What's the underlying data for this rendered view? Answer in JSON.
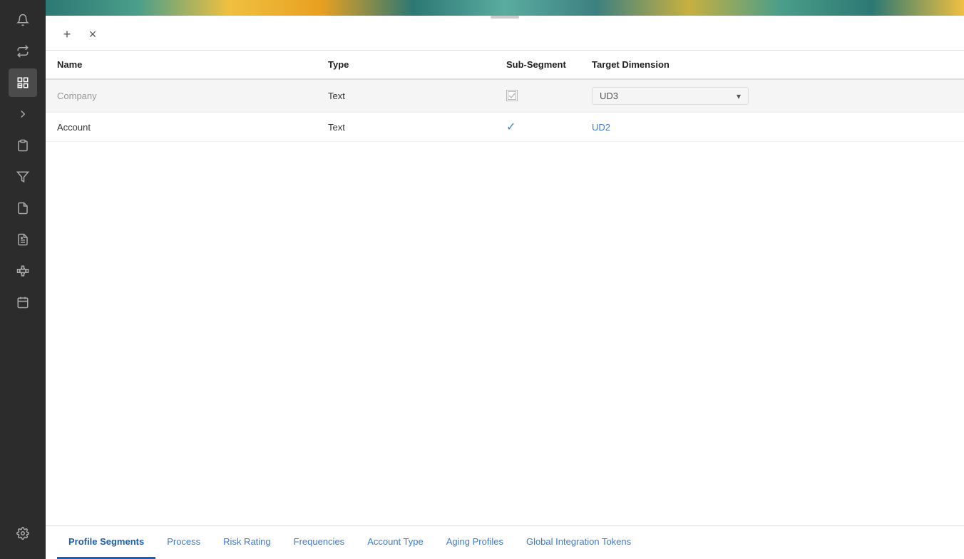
{
  "sidebar": {
    "icons": [
      {
        "name": "bell-icon",
        "symbol": "🔔"
      },
      {
        "name": "refresh-icon",
        "symbol": "⇄"
      },
      {
        "name": "profile-settings-icon",
        "symbol": "⚙",
        "active": true
      },
      {
        "name": "arrow-right-icon",
        "symbol": "→"
      },
      {
        "name": "clipboard-icon",
        "symbol": "📋"
      },
      {
        "name": "filter-icon",
        "symbol": "⊻"
      },
      {
        "name": "document-icon",
        "symbol": "📄"
      },
      {
        "name": "report-icon",
        "symbol": "📊"
      },
      {
        "name": "hierarchy-icon",
        "symbol": "⊞"
      },
      {
        "name": "calendar-icon",
        "symbol": "📅"
      },
      {
        "name": "settings-icon",
        "symbol": "⚙"
      }
    ]
  },
  "toolbar": {
    "add_label": "+",
    "remove_label": "×"
  },
  "table": {
    "columns": [
      "Name",
      "Type",
      "Sub-Segment",
      "Target Dimension"
    ],
    "rows": [
      {
        "name": "Company",
        "type": "Text",
        "sub_segment_checked": false,
        "sub_segment_disabled": true,
        "target_dimension": "UD3",
        "selected": true
      },
      {
        "name": "Account",
        "type": "Text",
        "sub_segment_checked": true,
        "sub_segment_disabled": false,
        "target_dimension": "UD2",
        "selected": false
      }
    ]
  },
  "tabs": [
    {
      "label": "Profile Segments",
      "active": true
    },
    {
      "label": "Process",
      "active": false
    },
    {
      "label": "Risk Rating",
      "active": false
    },
    {
      "label": "Frequencies",
      "active": false
    },
    {
      "label": "Account Type",
      "active": false
    },
    {
      "label": "Aging Profiles",
      "active": false
    },
    {
      "label": "Global Integration Tokens",
      "active": false
    }
  ],
  "colors": {
    "active_tab": "#1a5fb4",
    "link": "#3a7bd5",
    "sidebar_bg": "#2c2c2c",
    "check_color": "#3a7bd5"
  }
}
